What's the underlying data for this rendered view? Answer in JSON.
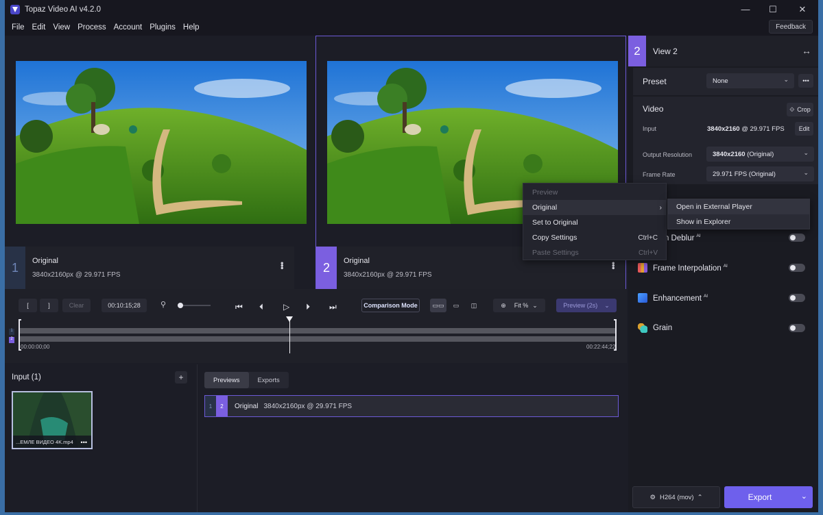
{
  "window": {
    "title": "Topaz Video AI  v4.2.0",
    "minimize": "—",
    "maximize": "☐",
    "close": "✕"
  },
  "menu": {
    "items": [
      "File",
      "Edit",
      "View",
      "Process",
      "Account",
      "Plugins",
      "Help"
    ],
    "feedback": "Feedback"
  },
  "viewers": [
    {
      "number": "1",
      "title": "Original",
      "details": "3840x2160px @ 29.971 FPS"
    },
    {
      "number": "2",
      "title": "Original",
      "details": "3840x2160px @ 29.971 FPS"
    }
  ],
  "right_panel": {
    "view_number": "2",
    "view_title": "View 2",
    "preset_label": "Preset",
    "preset_value": "None",
    "video_label": "Video",
    "crop_label": "Crop",
    "input_label": "Input",
    "input_res": "3840x2160",
    "input_fps": " @ 29.971 FPS",
    "edit_label": "Edit",
    "output_res_label": "Output Resolution",
    "output_res_bold": "3840x2160",
    "output_res_rest": " (Original)",
    "frame_rate_label": "Frame Rate",
    "frame_rate_value": "29.971 FPS (Original)",
    "features": [
      {
        "label": "ion Deblur",
        "ai": "AI",
        "enabled": false
      },
      {
        "label": "Frame Interpolation",
        "ai": "AI",
        "enabled": false
      },
      {
        "label": "Enhancement",
        "ai": "AI",
        "enabled": false
      },
      {
        "label": "Grain",
        "ai": "",
        "enabled": false
      }
    ],
    "codec": "H264 (mov)",
    "export": "Export"
  },
  "transport": {
    "mark_in": "[",
    "mark_out": "]",
    "clear": "Clear",
    "timecode": "00:10:15;28",
    "comparison_mode": "Comparison Mode",
    "zoom": "Fit %",
    "preview": "Preview (2s)",
    "time_start": "00:00:00;00",
    "time_end": "00:22:44;22",
    "track_labels": [
      "1",
      "2"
    ],
    "playhead_position": 0.4526
  },
  "input_panel": {
    "title": "Input (1)",
    "add": "+",
    "file_name": "...ЕМЛЕ ВИДЕО 4K.mp4"
  },
  "previews_panel": {
    "tabs": [
      "Previews",
      "Exports"
    ],
    "row": {
      "n1": "1",
      "n2": "2",
      "title": "Original",
      "details": "3840x2160px @ 29.971 FPS"
    }
  },
  "context_menu": {
    "items": [
      {
        "label": "Preview",
        "shortcut": "",
        "disabled": true
      },
      {
        "label": "Original",
        "shortcut": "",
        "submenu": true
      },
      {
        "label": "Set to Original",
        "shortcut": ""
      },
      {
        "label": "Copy Settings",
        "shortcut": "Ctrl+C"
      },
      {
        "label": "Paste Settings",
        "shortcut": "Ctrl+V",
        "disabled": true
      }
    ],
    "submenu_items": [
      "Open in External Player",
      "Show in Explorer"
    ]
  },
  "colors": {
    "accent": "#7b5fe0",
    "export_button": "#6e60ec",
    "view1_badge": "#283247"
  }
}
